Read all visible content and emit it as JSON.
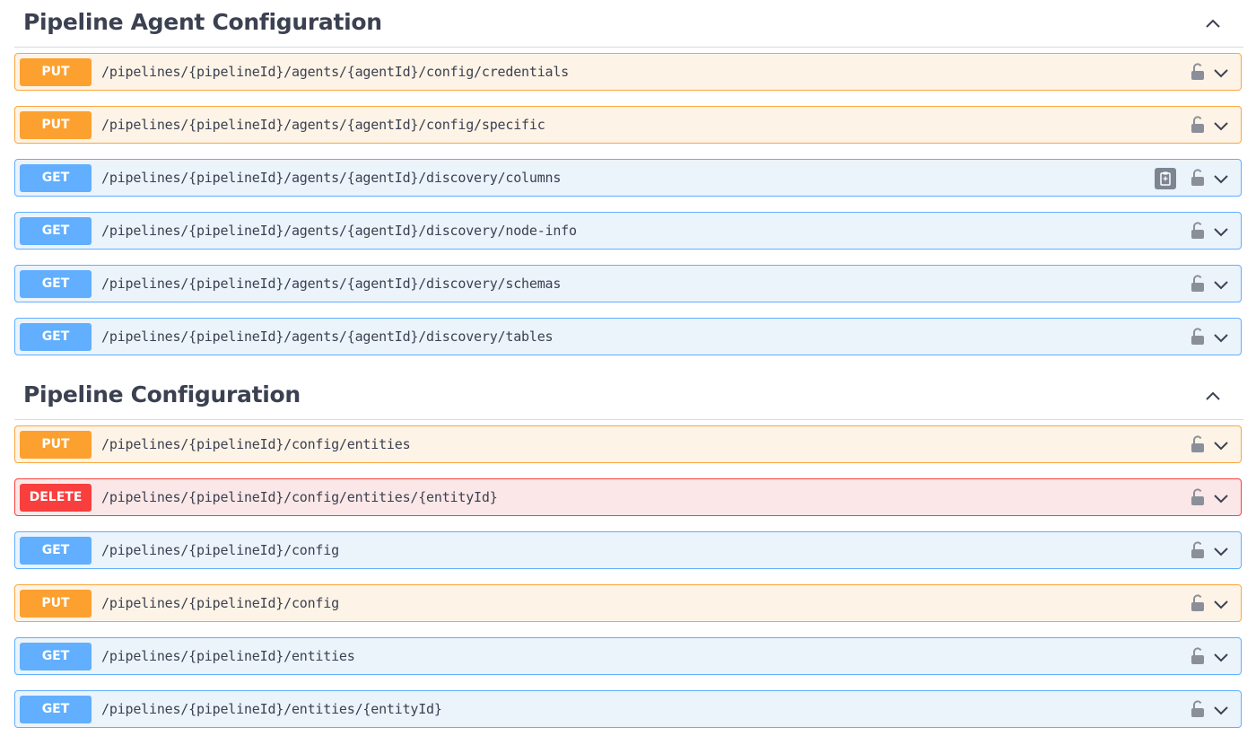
{
  "sections": [
    {
      "title": "Pipeline Agent Configuration",
      "operations": [
        {
          "method": "PUT",
          "path": "/pipelines/{pipelineId}/agents/{agentId}/config/credentials"
        },
        {
          "method": "PUT",
          "path": "/pipelines/{pipelineId}/agents/{agentId}/config/specific"
        },
        {
          "method": "GET",
          "path": "/pipelines/{pipelineId}/agents/{agentId}/discovery/columns"
        },
        {
          "method": "GET",
          "path": "/pipelines/{pipelineId}/agents/{agentId}/discovery/node-info"
        },
        {
          "method": "GET",
          "path": "/pipelines/{pipelineId}/agents/{agentId}/discovery/schemas"
        },
        {
          "method": "GET",
          "path": "/pipelines/{pipelineId}/agents/{agentId}/discovery/tables"
        }
      ]
    },
    {
      "title": "Pipeline Configuration",
      "operations": [
        {
          "method": "PUT",
          "path": "/pipelines/{pipelineId}/config/entities"
        },
        {
          "method": "DELETE",
          "path": "/pipelines/{pipelineId}/config/entities/{entityId}"
        },
        {
          "method": "GET",
          "path": "/pipelines/{pipelineId}/config"
        },
        {
          "method": "PUT",
          "path": "/pipelines/{pipelineId}/config"
        },
        {
          "method": "GET",
          "path": "/pipelines/{pipelineId}/entities"
        },
        {
          "method": "GET",
          "path": "/pipelines/{pipelineId}/entities/{entityId}"
        }
      ]
    }
  ],
  "colors": {
    "put": "#fca130",
    "get": "#61affe",
    "delete": "#f93e3e",
    "text": "#3b4151"
  },
  "icons": {
    "lock": "unlocked-padlock-icon",
    "expand": "chevron-down-icon",
    "collapse": "chevron-up-icon",
    "copy": "clipboard-copy-icon"
  }
}
